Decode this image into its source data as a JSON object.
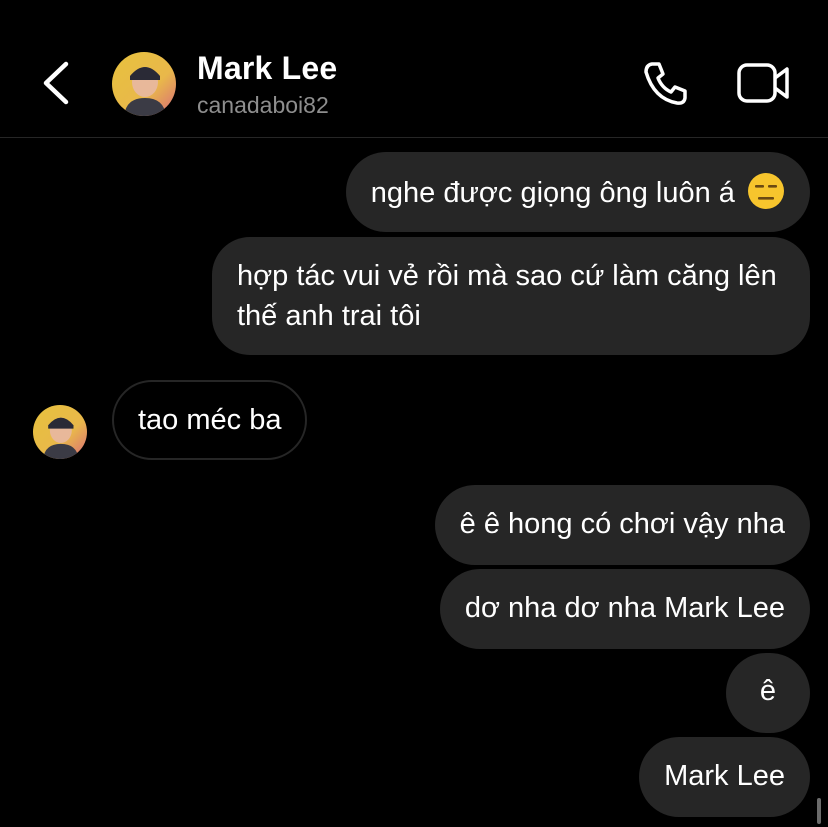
{
  "header": {
    "name": "Mark Lee",
    "username": "canadaboi82",
    "back_icon": "chevron-left-icon",
    "call_icon": "phone-icon",
    "video_icon": "video-camera-icon"
  },
  "messages": [
    {
      "direction": "outgoing",
      "text": "nghe được giọng ông luôn á",
      "emoji": "expressionless-face"
    },
    {
      "direction": "outgoing",
      "text": "hợp tác vui vẻ rồi mà sao cứ làm căng lên thế anh trai tôi"
    },
    {
      "direction": "incoming",
      "text": "tao méc ba"
    },
    {
      "direction": "outgoing",
      "text": "ê ê hong có chơi vậy nha"
    },
    {
      "direction": "outgoing",
      "text": "dơ nha dơ nha Mark Lee"
    },
    {
      "direction": "outgoing",
      "text": "ê"
    },
    {
      "direction": "outgoing",
      "text": "Mark Lee"
    }
  ],
  "colors": {
    "background": "#000000",
    "bubble_outgoing": "#262626",
    "secondary_text": "#8e8e8e"
  }
}
